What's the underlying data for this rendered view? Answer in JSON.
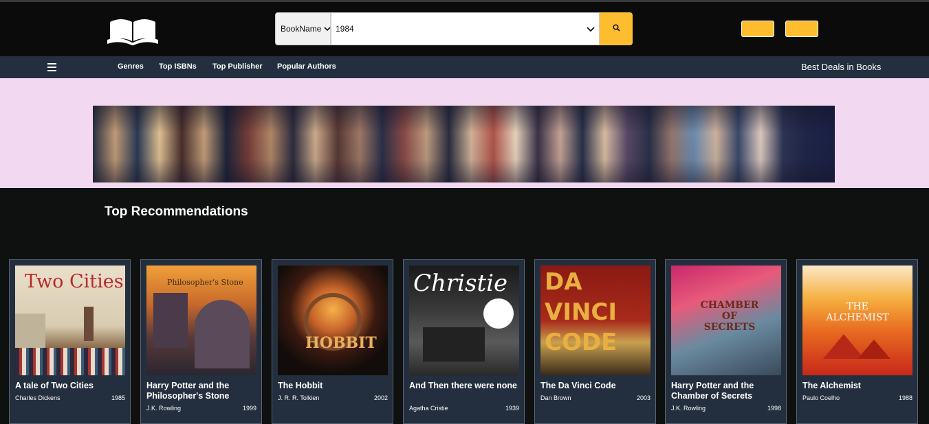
{
  "header": {
    "search": {
      "category_selected": "BookName",
      "query_value": "1984"
    }
  },
  "nav": {
    "links": [
      "Genres",
      "Top ISBNs",
      "Top Publisher",
      "Popular Authors"
    ],
    "deals_label": "Best Deals in Books"
  },
  "main": {
    "section_title": "Top Recommendations",
    "books": [
      {
        "title": "A tale of Two Cities",
        "author": "Charles Dickens",
        "year": "1985",
        "cover_text": "Two Cities"
      },
      {
        "title": "Harry Potter and the Philosopher's Stone",
        "author": "J.K. Rowling",
        "year": "1999",
        "cover_text": "Philosopher's Stone"
      },
      {
        "title": "The Hobbit",
        "author": "J. R. R. Tolkien",
        "year": "2002",
        "cover_text": "HOBBIT"
      },
      {
        "title": "And Then there were none",
        "author": "Agatha Cristie",
        "year": "1939",
        "cover_text": "Christie"
      },
      {
        "title": "The Da Vinci Code",
        "author": "Dan Brown",
        "year": "2003",
        "cover_text": "DA VINCI CODE"
      },
      {
        "title": "Harry Potter and the Chamber of Secrets",
        "author": "J.K. Rowling",
        "year": "1998",
        "cover_text": "CHAMBER OF SECRETS"
      },
      {
        "title": "The Alchemist",
        "author": "Paulo Coelho",
        "year": "1988",
        "cover_text": "THE ALCHEMIST"
      }
    ]
  },
  "colors": {
    "header_bg": "#0b0b0b",
    "nav_bg": "#232f3e",
    "accent": "#febd2f",
    "banner_bg": "#f2d8f0",
    "card_bg": "#232f3e"
  }
}
